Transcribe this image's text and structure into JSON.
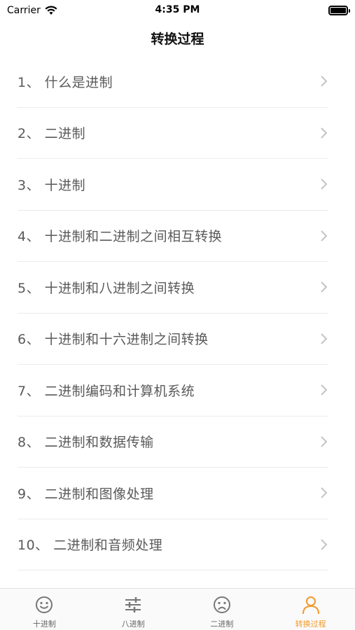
{
  "status": {
    "carrier": "Carrier",
    "time": "4:35 PM"
  },
  "nav": {
    "title": "转换过程"
  },
  "list": {
    "items": [
      {
        "label": "1、 什么是进制"
      },
      {
        "label": "2、 二进制"
      },
      {
        "label": "3、 十进制"
      },
      {
        "label": "4、 十进制和二进制之间相互转换"
      },
      {
        "label": "5、 十进制和八进制之间转换"
      },
      {
        "label": "6、 十进制和十六进制之间转换"
      },
      {
        "label": "7、 二进制编码和计算机系统"
      },
      {
        "label": "8、 二进制和数据传输"
      },
      {
        "label": "9、 二进制和图像处理"
      },
      {
        "label": "10、 二进制和音频处理"
      }
    ]
  },
  "tabs": [
    {
      "label": "十进制",
      "icon": "smile-icon"
    },
    {
      "label": "八进制",
      "icon": "sliders-icon"
    },
    {
      "label": "二进制",
      "icon": "sad-face-icon"
    },
    {
      "label": "转换过程",
      "icon": "person-icon",
      "active": true
    }
  ],
  "colors": {
    "accent": "#f39a2b",
    "text": "#5a5a5a",
    "divider": "#ececec"
  }
}
